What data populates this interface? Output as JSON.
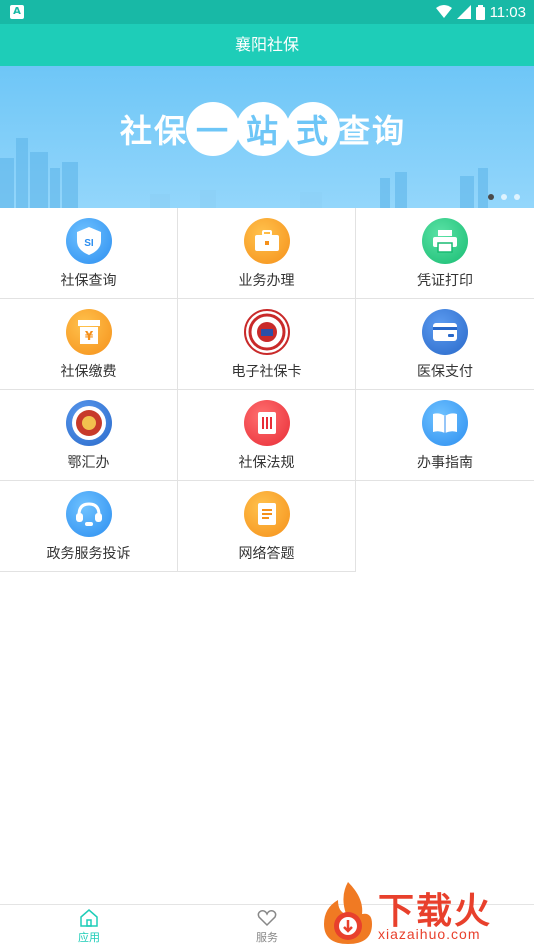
{
  "status_bar": {
    "time": "11:03",
    "app_badge": "A"
  },
  "header": {
    "title": "襄阳社保"
  },
  "banner": {
    "slogan_parts": [
      "社保",
      "一",
      "站",
      "式",
      "查询"
    ],
    "slide_count": 3,
    "active_slide": 1
  },
  "grid": {
    "items": [
      {
        "label": "社保查询",
        "icon": "si-shield-icon",
        "badge": "SI"
      },
      {
        "label": "业务办理",
        "icon": "briefcase-icon"
      },
      {
        "label": "凭证打印",
        "icon": "printer-icon"
      },
      {
        "label": "社保缴费",
        "icon": "payment-box-icon",
        "badge": "¥"
      },
      {
        "label": "电子社保卡",
        "icon": "social-security-seal-icon"
      },
      {
        "label": "医保支付",
        "icon": "card-icon"
      },
      {
        "label": "鄂汇办",
        "icon": "emblem-icon"
      },
      {
        "label": "社保法规",
        "icon": "document-icon"
      },
      {
        "label": "办事指南",
        "icon": "book-icon"
      },
      {
        "label": "政务服务投诉",
        "icon": "headset-icon"
      },
      {
        "label": "网络答题",
        "icon": "notes-icon"
      }
    ]
  },
  "tabs": [
    {
      "label": "应用",
      "icon": "home-icon",
      "active": true
    },
    {
      "label": "服务",
      "icon": "heart-icon",
      "active": false
    }
  ],
  "watermark": {
    "text": "下载火",
    "url": "xiazaihuo.com"
  },
  "colors": {
    "status_bar": "#18b9a6",
    "header": "#1ecdb8",
    "accent": "#1ecdb8",
    "watermark": "#e8402c"
  }
}
